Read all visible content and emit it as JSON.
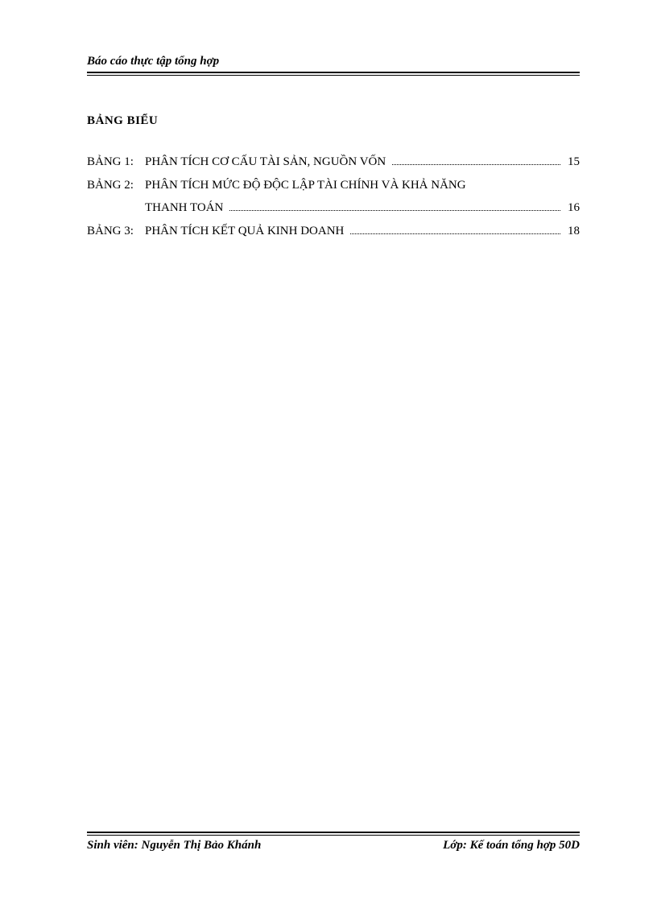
{
  "header": {
    "title": "Báo cáo thực tập tổng hợp"
  },
  "section": {
    "title": "BẢNG BIỂU"
  },
  "toc": [
    {
      "label": "BẢNG 1:",
      "title": "PHÂN TÍCH CƠ CẤU TÀI SẢN, NGUỒN VỐN",
      "page": "15",
      "cont": null
    },
    {
      "label": "BẢNG 2:",
      "title": "PHÂN TÍCH MỨC ĐỘ ĐỘC LẬP TÀI CHÍNH VÀ KHẢ NĂNG",
      "page": "",
      "cont": {
        "title": "THANH TOÁN",
        "page": "16"
      }
    },
    {
      "label": "BẢNG 3:",
      "title": "PHÂN TÍCH KẾT QUẢ KINH DOANH",
      "page": "18",
      "cont": null
    }
  ],
  "footer": {
    "student": "Sinh viên: Nguyễn Thị Bảo Khánh",
    "class": "Lớp: Kế toán tổng hợp 50D"
  }
}
